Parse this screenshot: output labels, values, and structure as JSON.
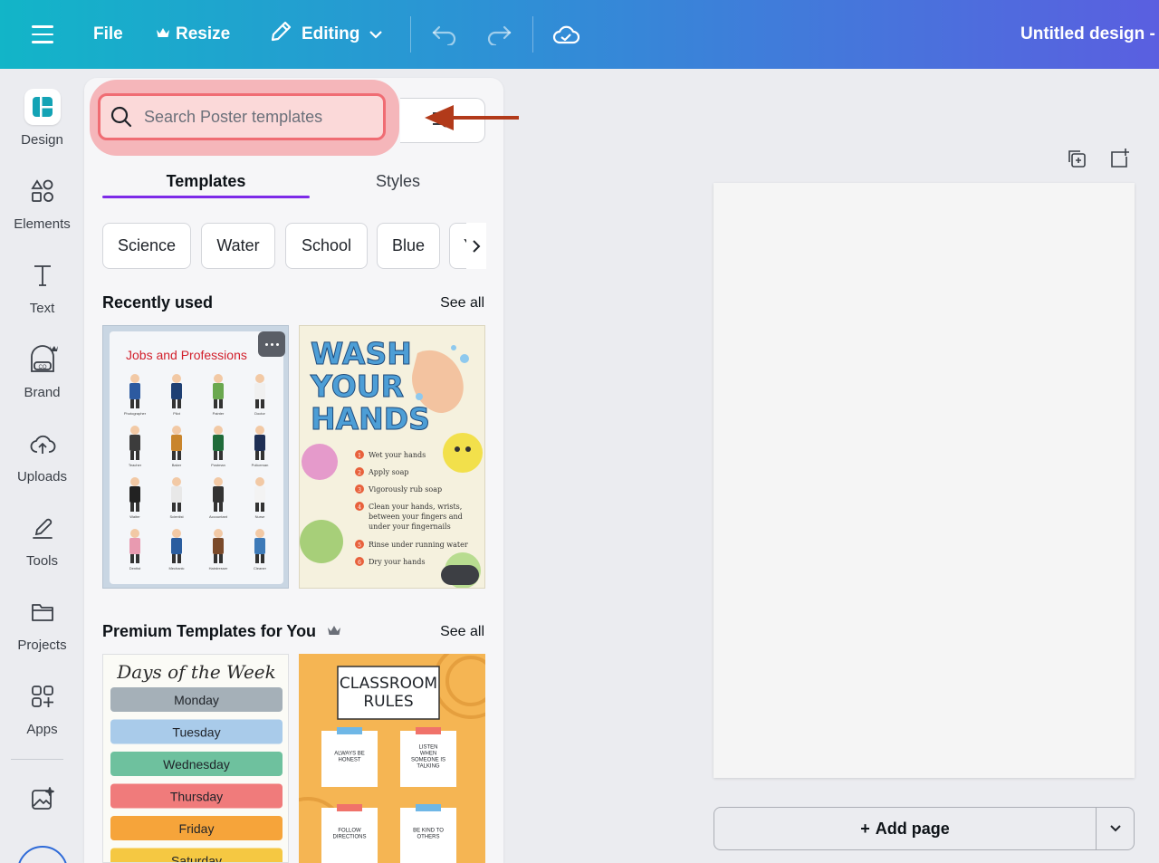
{
  "topbar": {
    "file": "File",
    "resize": "Resize",
    "editing": "Editing",
    "doc_title": "Untitled design - I"
  },
  "rail": {
    "items": [
      {
        "label": "Design",
        "icon": "design-icon"
      },
      {
        "label": "Elements",
        "icon": "elements-icon"
      },
      {
        "label": "Text",
        "icon": "text-icon"
      },
      {
        "label": "Brand",
        "icon": "brand-icon"
      },
      {
        "label": "Uploads",
        "icon": "uploads-icon"
      },
      {
        "label": "Tools",
        "icon": "tools-icon"
      },
      {
        "label": "Projects",
        "icon": "projects-icon"
      },
      {
        "label": "Apps",
        "icon": "apps-icon"
      }
    ]
  },
  "panel": {
    "search_placeholder": "Search Poster templates",
    "tabs": [
      "Templates",
      "Styles"
    ],
    "chips": [
      "Science",
      "Water",
      "School",
      "Blue",
      "Ye"
    ],
    "recently_used": {
      "title": "Recently used",
      "see_all": "See all",
      "thumb1": {
        "title": "Jobs and Professions",
        "labels": [
          "Photographer",
          "Pilot",
          "Painter",
          "Doctor",
          "Teacher",
          "Baker",
          "Postman",
          "Policeman",
          "Waiter",
          "Scientist",
          "Accountant",
          "Nurse",
          "Dentist",
          "Mechanic",
          "Hairdresser",
          "Cleaner"
        ]
      },
      "thumb2": {
        "title_lines": [
          "WASH",
          "YOUR",
          "HANDS"
        ],
        "steps": [
          "Wet your hands",
          "Apply soap",
          "Vigorously rub soap",
          "Clean your hands, wrists, between your fingers and under your fingernails",
          "Rinse under running water",
          "Dry your hands"
        ]
      }
    },
    "premium": {
      "title": "Premium Templates for You",
      "see_all": "See all",
      "thumb1": {
        "title": "Days of the Week",
        "days": [
          "Monday",
          "Tuesday",
          "Wednesday",
          "Thursday",
          "Friday",
          "Saturday"
        ]
      },
      "thumb2": {
        "title_lines": [
          "CLASSROOM",
          "RULES"
        ],
        "notes": [
          "ALWAYS BE HONEST",
          "LISTEN WHEN SOMEONE IS TALKING",
          "FOLLOW DIRECTIONS",
          "BE KIND TO OTHERS"
        ]
      }
    }
  },
  "canvas": {
    "add_page": "Add page"
  },
  "colors": {
    "accent": "#7d2ae8",
    "highlight": "#f06c73",
    "arrow": "#b23a1a"
  }
}
